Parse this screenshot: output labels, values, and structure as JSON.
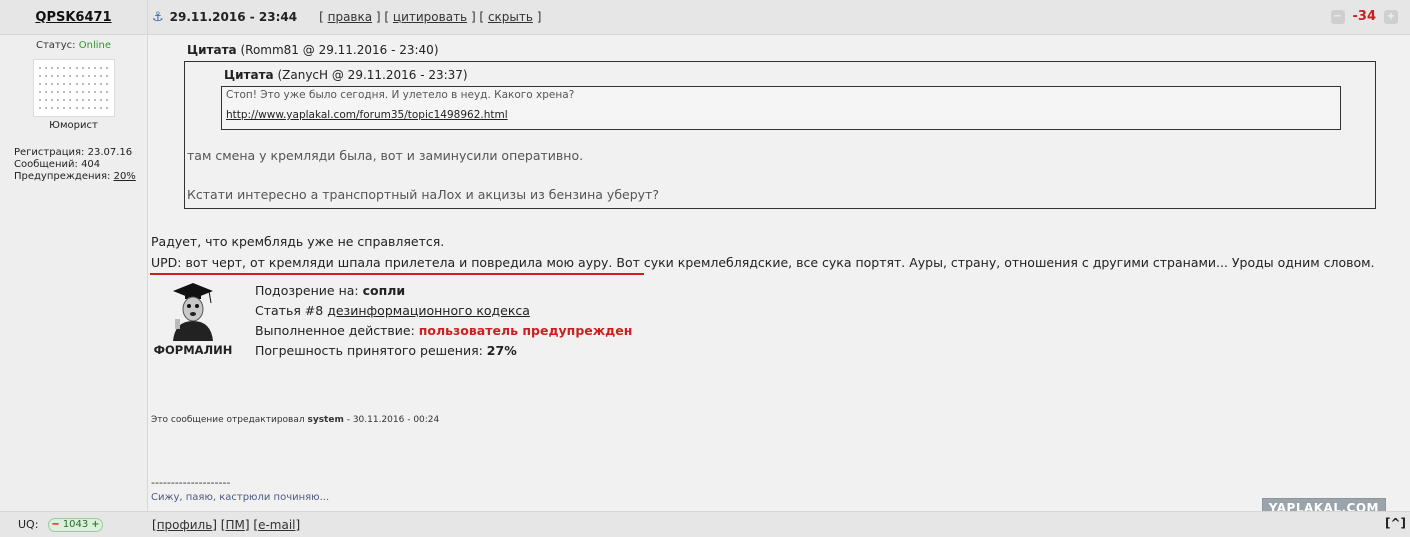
{
  "user": {
    "name": "QPSK6471",
    "status_label": "Статус:",
    "status_value": "Online",
    "rank": "Юморист",
    "reg_label": "Регистрация:",
    "reg_value": "23.07.16",
    "msgs_label": "Сообщений:",
    "msgs_value": "404",
    "warn_label": "Предупреждения:",
    "warn_value": "20%",
    "uq_label": "UQ:",
    "uq_value": "1043",
    "uq_minus": "−",
    "uq_plus": "+"
  },
  "post": {
    "anchor_icon": "⚓",
    "date": "29.11.2016 - 23:44",
    "link_edit": "правка",
    "link_quote": "цитировать",
    "link_hide": "скрыть",
    "rating": "-34",
    "quote1": {
      "label": "Цитата",
      "meta": " (Romm81 @ 29.11.2016 - 23:40)",
      "text1": "там смена у кремляди была, вот и заминусили оперативно.",
      "text2": "Кстати интересно а транспортный наЛох и акцизы из бензина уберут?"
    },
    "quote2": {
      "label": "Цитата",
      "meta": " (ZanycH @ 29.11.2016 - 23:37)",
      "text": "Стоп! Это уже было сегодня. И улетело в неуд. Какого хрена?",
      "link": "http://www.yaplakal.com/forum35/topic1498962.html"
    },
    "text_line1": "Радует, что кремблядь уже не справляется.",
    "text_line2": "UPD: вот черт, от кремляди шпала прилетела и повредила мою ауру. Вот суки кремлеблядские, все сука портят. Ауры, страну, отношения с другими странами... Уроды одним словом.",
    "moderator": {
      "name": "ФОРМАЛИН",
      "l1_label": "Подозрение на: ",
      "l1_value": "сопли",
      "l2_label": "Статья #8 ",
      "l2_link": "дезинформационного кодекса",
      "l3_label": "Выполненное действие: ",
      "l3_value": "пользователь предупрежден",
      "l4_label": "Погрешность принятого решения: ",
      "l4_value": "27%"
    },
    "edited_prefix": "Это сообщение отредактировал ",
    "edited_user": "system",
    "edited_suffix": " - 30.11.2016 - 00:24",
    "sig_line": "--------------------",
    "sig_text": "Сижу, паяю, кастрюли починяю...",
    "logo": "YAPLAKAL.COM",
    "foot_profile": "профиль",
    "foot_pm": "ПМ",
    "foot_email": "e-mail",
    "up_label": "[^]"
  }
}
